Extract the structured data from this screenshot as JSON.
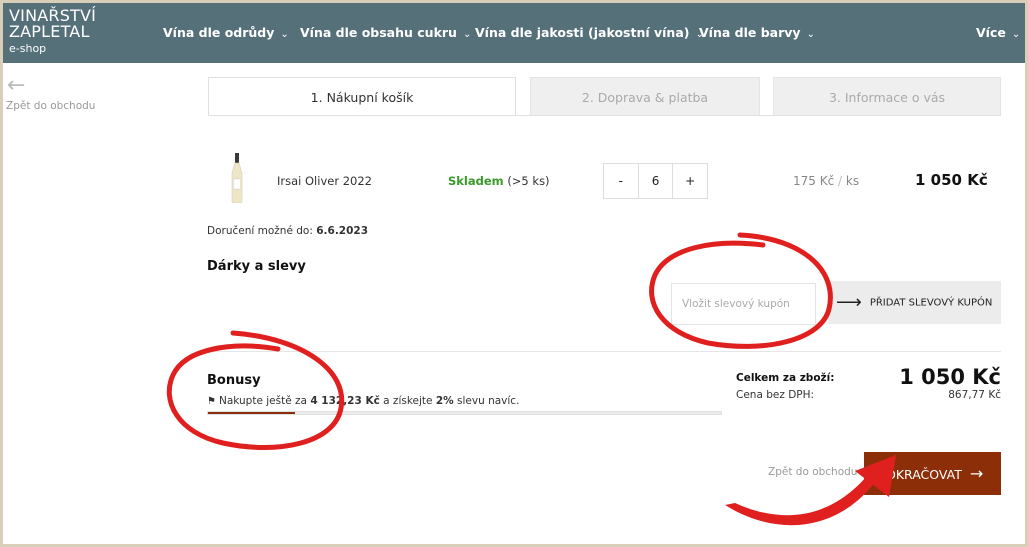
{
  "header": {
    "logo_line1": "VINAŘSTVÍ",
    "logo_line2": "ZAPLETAL",
    "logo_line3": "e-shop",
    "nav": [
      {
        "label": "Vína dle odrůdy"
      },
      {
        "label": "Vína dle obsahu cukru"
      },
      {
        "label": "Vína dle jakosti (jakostní vína)"
      },
      {
        "label": "Vína dle barvy"
      },
      {
        "label": "Více"
      }
    ]
  },
  "back": {
    "label": "Zpět do obchodu"
  },
  "tabs": [
    {
      "label": "1. Nákupní košík",
      "active": true
    },
    {
      "label": "2. Doprava & platba",
      "active": false
    },
    {
      "label": "3. Informace o vás",
      "active": false
    }
  ],
  "cart": {
    "item": {
      "name": "Irsai Oliver 2022",
      "stock_status": "Skladem",
      "stock_count": "(>5 ks)",
      "quantity": "6",
      "minus": "-",
      "plus": "+",
      "unit_price": "175 Kč",
      "unit_sep": "/",
      "unit": "ks",
      "total": "1 050 Kč"
    },
    "delivery_label": "Doručení možné do:",
    "delivery_date": "6.6.2023"
  },
  "gifts": {
    "title": "Dárky a slevy",
    "coupon_placeholder": "Vložit slevový kupón",
    "coupon_button": "PŘIDAT SLEVOVÝ KUPÓN"
  },
  "bonus": {
    "title": "Bonusy",
    "text_pre": "Nakupte ještě za",
    "amount": "4 132,23 Kč",
    "text_mid": "a získejte",
    "percent": "2%",
    "text_post": "slevu navíc.",
    "progress": 0.17
  },
  "summary": {
    "total_label": "Celkem za zboží:",
    "total_value": "1 050 Kč",
    "net_label": "Cena bez DPH:",
    "net_value": "867,77 Kč"
  },
  "footer": {
    "back_label": "Zpět do obchodu",
    "continue_label": "OKRAČOVAT"
  },
  "colors": {
    "header_bg": "#56707a",
    "accent": "#8c2f09",
    "stock_green": "#3a9a2a",
    "annotation_red": "#e0201e"
  }
}
